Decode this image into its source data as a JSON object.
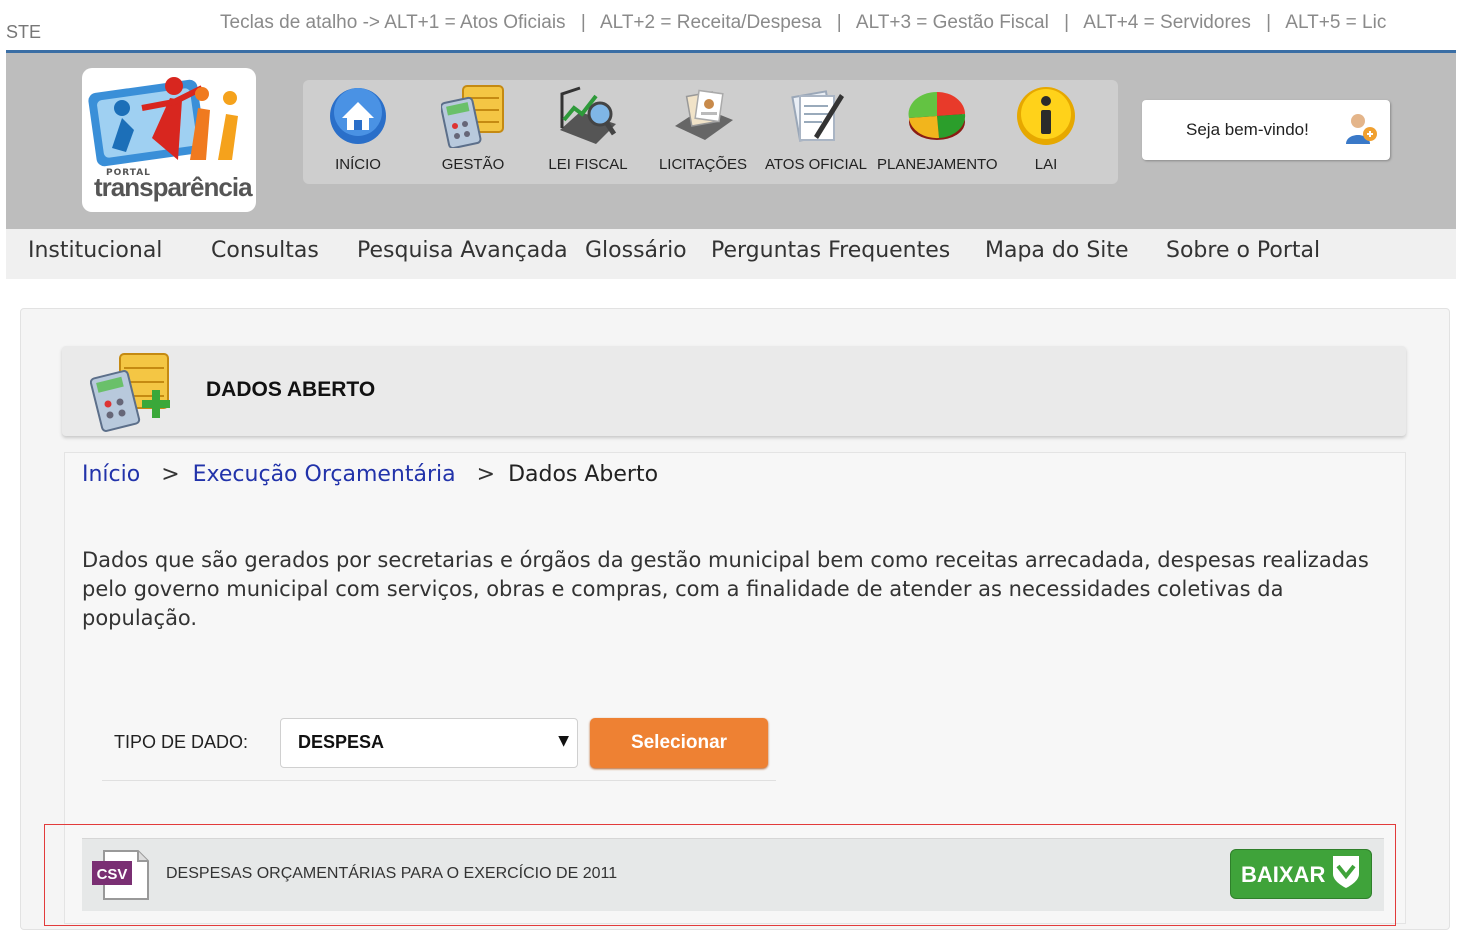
{
  "topbar": {
    "left_text": "STE",
    "shortcuts": [
      "Teclas de atalho -> ALT+1 = Atos Oficiais",
      "ALT+2 = Receita/Despesa",
      "ALT+3 = Gestão Fiscal",
      "ALT+4 = Servidores",
      "ALT+5 = Lic"
    ],
    "separator": "|"
  },
  "logo": {
    "small": "PORTAL",
    "big": "transparência"
  },
  "nav": {
    "items": [
      {
        "label": "INÍCIO",
        "icon": "home-icon"
      },
      {
        "label": "GESTÃO",
        "icon": "calculator-icon"
      },
      {
        "label": "LEI FISCAL",
        "icon": "chart-magnifier-icon"
      },
      {
        "label": "LICITAÇÕES",
        "icon": "documents-icon"
      },
      {
        "label": "ATOS OFICIAL",
        "icon": "document-pen-icon"
      },
      {
        "label": "PLANEJAMENTO",
        "icon": "pie-chart-icon"
      },
      {
        "label": "LAI",
        "icon": "info-icon"
      }
    ]
  },
  "welcome": {
    "text": "Seja bem-vindo!",
    "icon": "user-icon"
  },
  "menu": {
    "items": [
      "Institucional",
      "Consultas",
      "Pesquisa Avançada",
      "Glossário",
      "Perguntas Frequentes",
      "Mapa do Site",
      "Sobre o Portal"
    ]
  },
  "page": {
    "title": "DADOS ABERTO",
    "title_icon": "calculator-add-icon",
    "breadcrumb": {
      "home": "Início",
      "section": "Execução Orçamentária",
      "current": "Dados Aberto",
      "sep": ">"
    },
    "description": "Dados que são gerados por secretarias e órgãos da gestão municipal bem como receitas arrecadada, despesas realizadas pelo governo municipal com serviços, obras e compras, com a finalidade de atender as necessidades coletivas da população."
  },
  "form": {
    "label": "TIPO DE DADO:",
    "selected": "DESPESA",
    "button": "Selecionar"
  },
  "files": [
    {
      "type": "CSV",
      "title": "DESPESAS ORÇAMENTÁRIAS PARA O EXERCÍCIO DE 2011",
      "button": "BAIXAR"
    }
  ],
  "colors": {
    "accent_orange": "#ee8133",
    "download_green": "#3fa33a",
    "link_blue": "#2233aa",
    "header_gray": "#bdbdbd",
    "highlight_red": "#e23b3b"
  }
}
